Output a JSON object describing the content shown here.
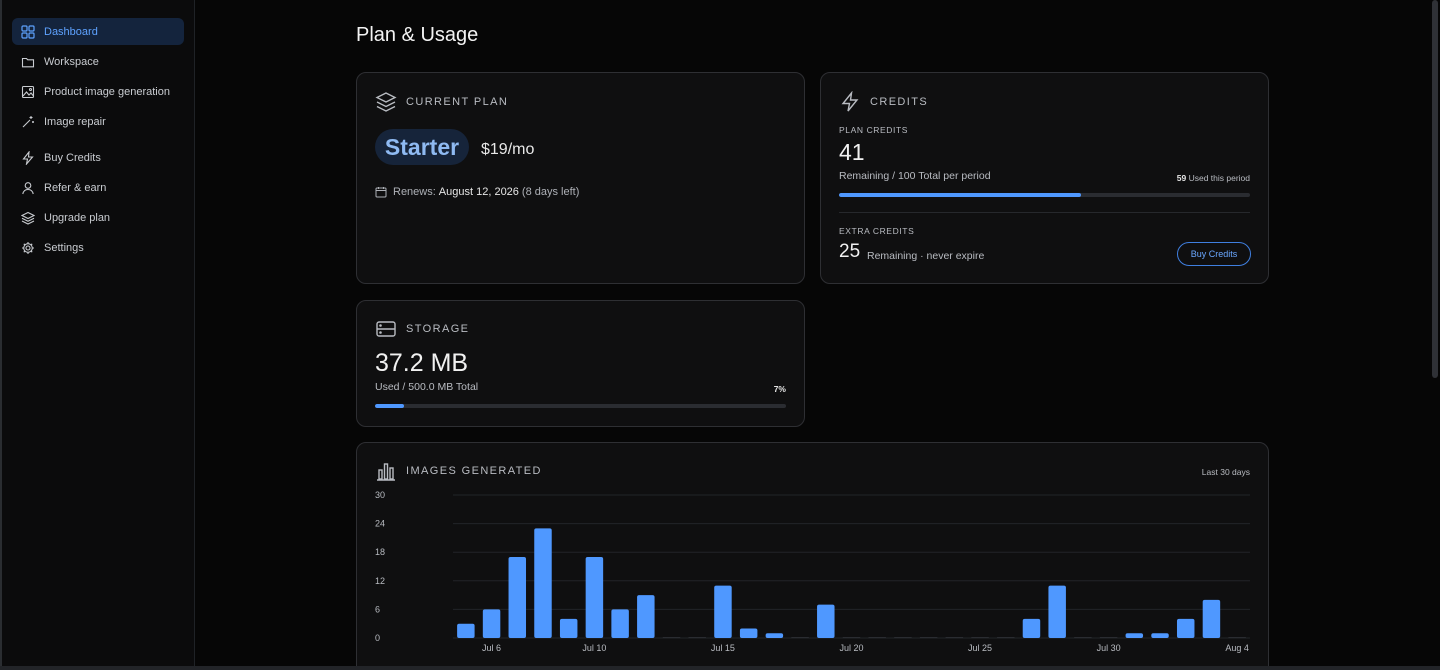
{
  "sidebar": {
    "items": [
      {
        "label": "Dashboard",
        "icon": "grid-icon"
      },
      {
        "label": "Workspace",
        "icon": "folder-icon"
      },
      {
        "label": "Product image generation",
        "icon": "image-icon"
      },
      {
        "label": "Image repair",
        "icon": "magic-wand-icon"
      },
      {
        "label": "Buy Credits",
        "icon": "lightning-icon"
      },
      {
        "label": "Refer & earn",
        "icon": "user-icon"
      },
      {
        "label": "Upgrade plan",
        "icon": "layers-icon"
      },
      {
        "label": "Settings",
        "icon": "gear-icon"
      }
    ]
  },
  "page": {
    "title": "Plan & Usage"
  },
  "plan": {
    "heading": "CURRENT PLAN",
    "name": "Starter",
    "price": "$19/mo",
    "renews_label": "Renews:",
    "renews_date": "August 12, 2026",
    "renews_left": "(8 days left)"
  },
  "credits": {
    "heading": "CREDITS",
    "plan_label": "PLAN CREDITS",
    "plan_remaining": "41",
    "plan_sub": "Remaining / 100 Total per period",
    "used_count": "59",
    "used_label": "Used this period",
    "plan_fraction_remaining": 0.59,
    "extra_label": "EXTRA CREDITS",
    "extra_remaining": "25",
    "extra_sub": "Remaining · never expire",
    "buy_button": "Buy Credits"
  },
  "storage": {
    "heading": "STORAGE",
    "used": "37.2 MB",
    "sub": "Used / 500.0 MB Total",
    "percent_label": "7%",
    "fraction": 0.07
  },
  "images": {
    "heading": "IMAGES GENERATED",
    "range": "Last 30 days"
  },
  "chart_data": {
    "type": "bar",
    "title": "IMAGES GENERATED",
    "ylim": [
      0,
      30
    ],
    "yticks": [
      0,
      6,
      12,
      18,
      24,
      30
    ],
    "grid": true,
    "categories": [
      "Jul 5",
      "Jul 6",
      "Jul 7",
      "Jul 8",
      "Jul 9",
      "Jul 10",
      "Jul 11",
      "Jul 12",
      "Jul 13",
      "Jul 14",
      "Jul 15",
      "Jul 16",
      "Jul 17",
      "Jul 18",
      "Jul 19",
      "Jul 20",
      "Jul 21",
      "Jul 22",
      "Jul 23",
      "Jul 24",
      "Jul 25",
      "Jul 26",
      "Jul 27",
      "Jul 28",
      "Jul 29",
      "Jul 30",
      "Jul 31",
      "Aug 1",
      "Aug 2",
      "Aug 3",
      "Aug 4"
    ],
    "xtick_labels": [
      "Jul 6",
      "Jul 10",
      "Jul 15",
      "Jul 20",
      "Jul 25",
      "Jul 30",
      "Aug 4"
    ],
    "values": [
      3,
      6,
      17,
      23,
      4,
      17,
      6,
      9,
      0,
      0,
      11,
      2,
      1,
      0,
      7,
      0,
      0,
      0,
      0,
      0,
      0,
      0,
      4,
      11,
      0,
      0,
      1,
      1,
      4,
      8,
      0
    ],
    "color": "#4f98ff"
  }
}
